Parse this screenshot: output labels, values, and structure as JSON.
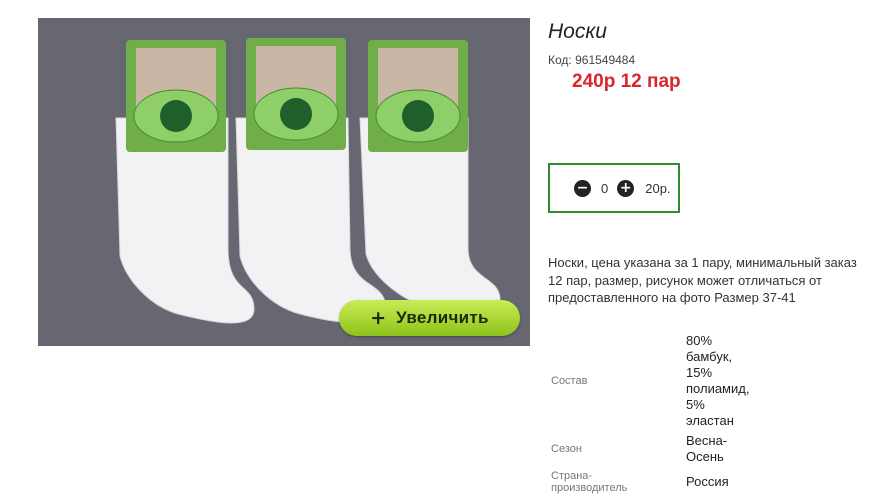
{
  "product": {
    "title": "Носки",
    "code_label": "Код:",
    "code_value": "961549484",
    "promo": "240р 12 пар",
    "zoom_button": "Увеличить",
    "zoom_plus": "+",
    "quantity": "0",
    "price": "20р.",
    "minus_icon": "minus-circle-icon",
    "plus_icon": "plus-circle-icon",
    "description": "Носки, цена указана за 1 пару, минимальный заказ 12 пар, размер, рисунок может отличаться от предоставленного на фото Размер 37-41"
  },
  "properties": [
    {
      "key": "Состав",
      "value_lines": [
        "80%",
        "бамбук,",
        "15%",
        "полиамид,",
        "5%",
        "эластан"
      ]
    },
    {
      "key": "Сезон",
      "value_lines": [
        "Весна-",
        "Осень"
      ]
    },
    {
      "key_lines": [
        "Страна-",
        "производитель"
      ],
      "value_lines": [
        "Россия"
      ]
    }
  ],
  "colors": {
    "photo_bg": "#666770",
    "promo": "#d9262b",
    "qty_border": "#2e8b2e",
    "zoom_button": "#a6d62f"
  }
}
